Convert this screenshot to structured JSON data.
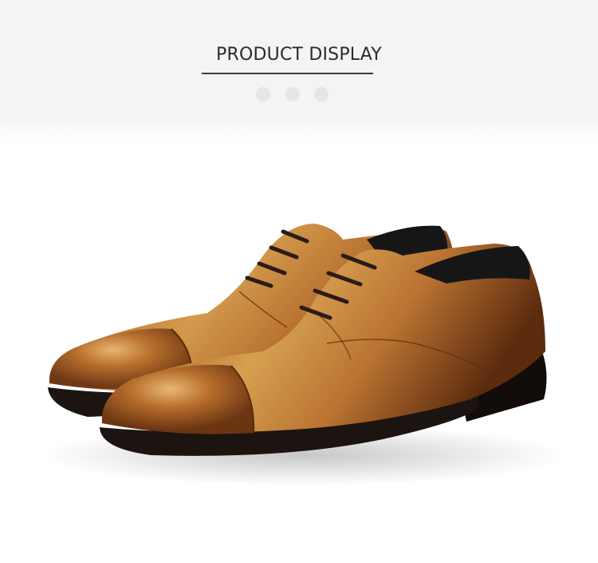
{
  "header": {
    "title": "PRODUCT DISPLAY",
    "pager_dots": 3,
    "active_dot": 1
  },
  "image": {
    "subject": "shoes-icon",
    "colors": {
      "leather_light": "#c98a3f",
      "leather_mid": "#a75f22",
      "leather_dark": "#6a3412",
      "sole": "#1c1410",
      "lace": "#2a1c17",
      "lining": "#161616"
    }
  }
}
